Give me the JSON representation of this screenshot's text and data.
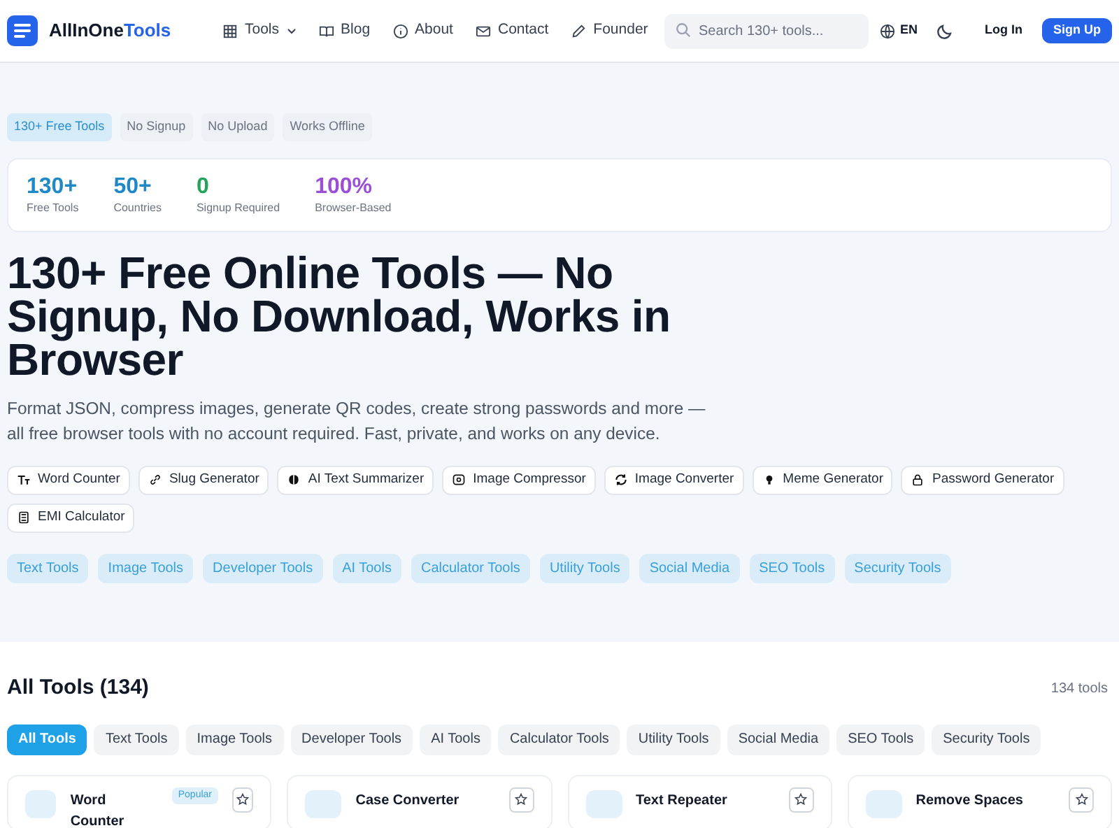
{
  "header": {
    "brand": {
      "main": "AllInOne",
      "accent": "Tools"
    },
    "nav": [
      {
        "label": "Tools",
        "dropdown": true
      },
      {
        "label": "Blog",
        "dropdown": false
      },
      {
        "label": "About",
        "dropdown": false
      },
      {
        "label": "Contact",
        "dropdown": false
      },
      {
        "label": "Founder",
        "dropdown": false
      }
    ],
    "search": {
      "placeholder": "Search 130+ tools..."
    },
    "language": "EN",
    "login": "Log In",
    "signup": "Sign Up"
  },
  "hero": {
    "badges": [
      {
        "label": "130+ Free Tools",
        "selected": true
      },
      {
        "label": "No Signup",
        "selected": false
      },
      {
        "label": "No Upload",
        "selected": false
      },
      {
        "label": "Works Offline",
        "selected": false
      }
    ],
    "stats": [
      {
        "value": "130+",
        "label": "Free Tools",
        "color": "#1e88c8"
      },
      {
        "value": "50+",
        "label": "Countries",
        "color": "#1e88c8"
      },
      {
        "value": "0",
        "label": "Signup Required",
        "color": "#22a55a"
      },
      {
        "value": "100%",
        "label": "Browser-Based",
        "color": "#9b4fd6"
      }
    ],
    "title": "130+ Free Online Tools — No Signup, No Download, Works in Browser",
    "description": "Format JSON, compress images, generate QR codes, create strong passwords and more — all free browser tools with no account required. Fast, private, and works on any device.",
    "quick_tools": [
      "Word Counter",
      "Slug Generator",
      "AI Text Summarizer",
      "Image Compressor",
      "Image Converter",
      "Meme Generator",
      "Password Generator",
      "EMI Calculator"
    ],
    "categories": [
      "Text Tools",
      "Image Tools",
      "Developer Tools",
      "AI Tools",
      "Calculator Tools",
      "Utility Tools",
      "Social Media",
      "SEO Tools",
      "Security Tools"
    ]
  },
  "tools_section": {
    "title": "All Tools (134)",
    "count": "134 tools",
    "filters": [
      {
        "label": "All Tools",
        "selected": true
      },
      {
        "label": "Text Tools",
        "selected": false
      },
      {
        "label": "Image Tools",
        "selected": false
      },
      {
        "label": "Developer Tools",
        "selected": false
      },
      {
        "label": "AI Tools",
        "selected": false
      },
      {
        "label": "Calculator Tools",
        "selected": false
      },
      {
        "label": "Utility Tools",
        "selected": false
      },
      {
        "label": "Social Media",
        "selected": false
      },
      {
        "label": "SEO Tools",
        "selected": false
      },
      {
        "label": "Security Tools",
        "selected": false
      }
    ],
    "cards": [
      {
        "title": "Word Counter",
        "badge": "Popular"
      },
      {
        "title": "Case Converter"
      },
      {
        "title": "Text Repeater"
      },
      {
        "title": "Remove Spaces"
      }
    ]
  }
}
